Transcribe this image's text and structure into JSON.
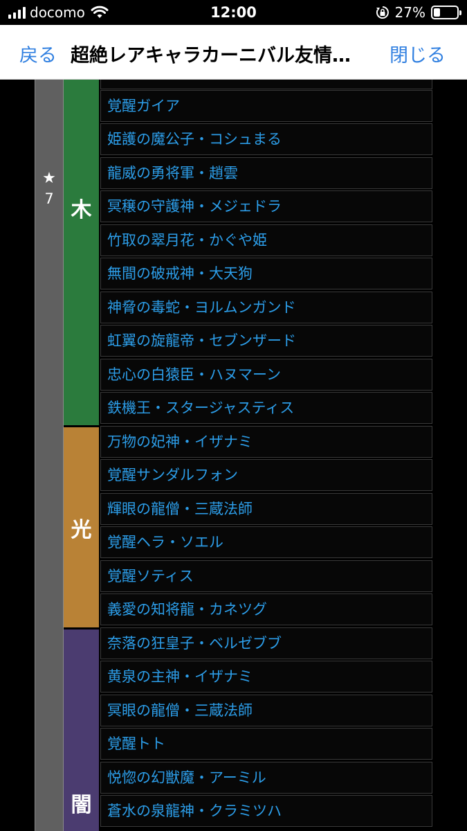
{
  "status_bar": {
    "carrier": "docomo",
    "time": "12:00",
    "battery_percent": "27%"
  },
  "nav": {
    "back": "戻る",
    "title": "超絶レアキャラカーニバル友情…",
    "close": "閉じる"
  },
  "rarity": {
    "star": "★",
    "number": "7"
  },
  "attributes": {
    "wood": "木",
    "light": "光",
    "dark": "闇"
  },
  "rows": [
    "覚醒ガイア",
    "姫護の魔公子・コシュまる",
    "龍威の勇将軍・趙雲",
    "冥穣の守護神・メジェドラ",
    "竹取の翠月花・かぐや姫",
    "無間の破戒神・大天狗",
    "神脅の毒蛇・ヨルムンガンド",
    "虹翼の旋龍帝・セブンザード",
    "忠心の白猿臣・ハヌマーン",
    "鉄機王・スタージャスティス",
    "万物の妃神・イザナミ",
    "覚醒サンダルフォン",
    "輝眼の龍僧・三蔵法師",
    "覚醒ヘラ・ソエル",
    "覚醒ソティス",
    "義愛の知将龍・カネツグ",
    "奈落の狂皇子・ベルゼブブ",
    "黄泉の主神・イザナミ",
    "冥眼の龍僧・三蔵法師",
    "覚醒トト",
    "悦惚の幻獣魔・アーミル",
    "蒼水の泉龍神・クラミツハ"
  ]
}
